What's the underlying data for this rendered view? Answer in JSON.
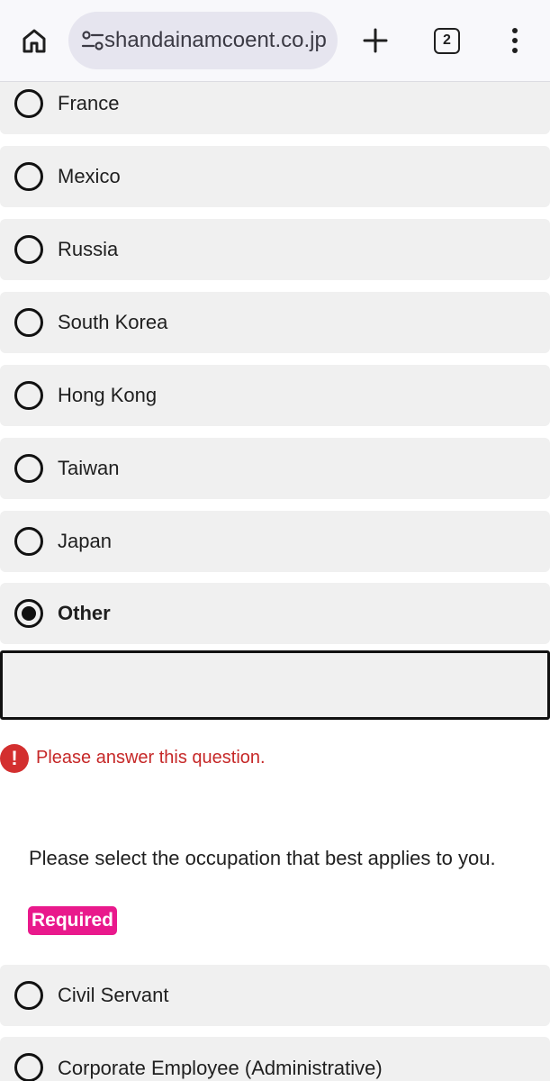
{
  "browser": {
    "url": "shandainamcoent.co.jp",
    "tab_count": "2",
    "icons": [
      "home-icon",
      "site-settings-icon",
      "new-tab-icon",
      "tab-switcher-icon",
      "more-menu-icon"
    ]
  },
  "country_options": [
    {
      "label": "France",
      "checked": false
    },
    {
      "label": "Mexico",
      "checked": false
    },
    {
      "label": "Russia",
      "checked": false
    },
    {
      "label": "South Korea",
      "checked": false
    },
    {
      "label": "Hong Kong",
      "checked": false
    },
    {
      "label": "Taiwan",
      "checked": false
    },
    {
      "label": "Japan",
      "checked": false
    },
    {
      "label": "Other",
      "checked": true
    }
  ],
  "other_input": {
    "value": ""
  },
  "error": {
    "message": "Please answer this question."
  },
  "occupation_question": {
    "text": "Please select the occupation that best applies to you.",
    "required_label": "Required",
    "options": [
      {
        "label": "Civil Servant",
        "checked": false
      },
      {
        "label": "Corporate Employee (Administrative)",
        "checked": false
      }
    ]
  },
  "colors": {
    "error": "#c62828",
    "required_badge": "#e9198c",
    "option_bg": "#f0f0f0"
  }
}
